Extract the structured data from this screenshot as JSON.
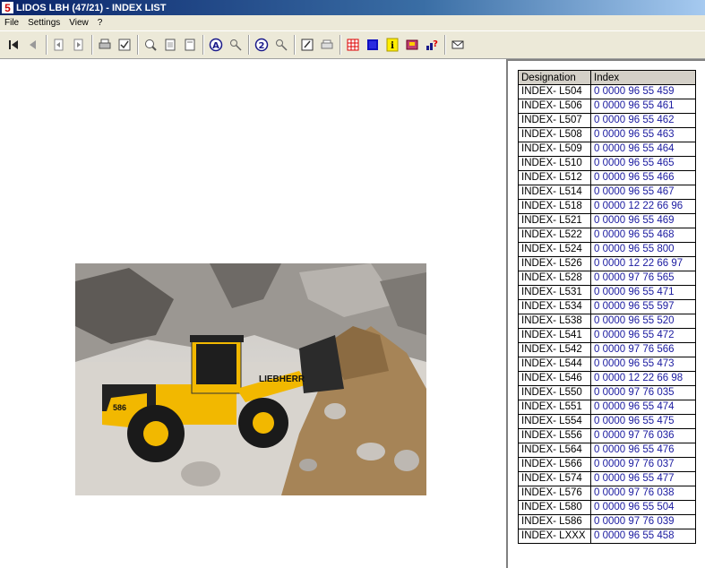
{
  "window": {
    "title": "LIDOS LBH (47/21) - INDEX LIST",
    "logo_glyph": "5"
  },
  "menu": {
    "file": "File",
    "settings": "Settings",
    "view": "View",
    "help": "?"
  },
  "toolbar": {
    "icons": [
      "first-page-icon",
      "prev-page-icon",
      "prev-doc-icon",
      "next-doc-icon",
      "print-icon",
      "print-setup-icon",
      "zoom-in-icon",
      "fit-page-icon",
      "page-icon",
      "search-a-icon",
      "search-tools-icon",
      "search-2-icon",
      "search-tool-2-icon",
      "edit-icon",
      "printer-icon",
      "grid-icon",
      "blue-square-icon",
      "info-icon",
      "book-icon",
      "help-icon",
      "mail-icon"
    ]
  },
  "index_table": {
    "headers": {
      "designation": "Designation",
      "index": "Index"
    },
    "rows": [
      {
        "designation": "INDEX- L504",
        "index": "0 0000 96 55 459"
      },
      {
        "designation": "INDEX- L506",
        "index": "0 0000 96 55 461"
      },
      {
        "designation": "INDEX- L507",
        "index": "0 0000 96 55 462"
      },
      {
        "designation": "INDEX- L508",
        "index": "0 0000 96 55 463"
      },
      {
        "designation": "INDEX- L509",
        "index": "0 0000 96 55 464"
      },
      {
        "designation": "INDEX- L510",
        "index": "0 0000 96 55 465"
      },
      {
        "designation": "INDEX- L512",
        "index": "0 0000 96 55 466"
      },
      {
        "designation": "INDEX- L514",
        "index": "0 0000 96 55 467"
      },
      {
        "designation": "INDEX- L518",
        "index": "0 0000 12 22 66 96"
      },
      {
        "designation": "INDEX- L521",
        "index": "0 0000 96 55 469"
      },
      {
        "designation": "INDEX- L522",
        "index": "0 0000 96 55 468"
      },
      {
        "designation": "INDEX- L524",
        "index": "0 0000 96 55 800"
      },
      {
        "designation": "INDEX- L526",
        "index": "0 0000 12 22 66 97"
      },
      {
        "designation": "INDEX- L528",
        "index": "0 0000 97 76 565"
      },
      {
        "designation": "INDEX- L531",
        "index": "0 0000 96 55 471"
      },
      {
        "designation": "INDEX- L534",
        "index": "0 0000 96 55 597"
      },
      {
        "designation": "INDEX- L538",
        "index": "0 0000 96 55 520"
      },
      {
        "designation": "INDEX- L541",
        "index": "0 0000 96 55 472"
      },
      {
        "designation": "INDEX- L542",
        "index": "0 0000 97 76 566"
      },
      {
        "designation": "INDEX- L544",
        "index": "0 0000 96 55 473"
      },
      {
        "designation": "INDEX- L546",
        "index": "0 0000 12 22 66 98"
      },
      {
        "designation": "INDEX- L550",
        "index": "0 0000 97 76 035"
      },
      {
        "designation": "INDEX- L551",
        "index": "0 0000 96 55 474"
      },
      {
        "designation": "INDEX- L554",
        "index": "0 0000 96 55 475"
      },
      {
        "designation": "INDEX- L556",
        "index": "0 0000 97 76 036"
      },
      {
        "designation": "INDEX- L564",
        "index": "0 0000 96 55 476"
      },
      {
        "designation": "INDEX- L566",
        "index": "0 0000 97 76 037"
      },
      {
        "designation": "INDEX- L574",
        "index": "0 0000 96 55 477"
      },
      {
        "designation": "INDEX- L576",
        "index": "0 0000 97 76 038"
      },
      {
        "designation": "INDEX- L580",
        "index": "0 0000 96 55 504"
      },
      {
        "designation": "INDEX- L586",
        "index": "0 0000 97 76 039"
      },
      {
        "designation": "INDEX- LXXX",
        "index": "0 0000 96 55 458"
      }
    ]
  },
  "picture": {
    "brand_text": "LIEBHERR",
    "model_text": "586"
  },
  "colors": {
    "titlebar": "#0a246a",
    "index_text": "#1a1aa0",
    "machine_yellow": "#f2b800"
  }
}
